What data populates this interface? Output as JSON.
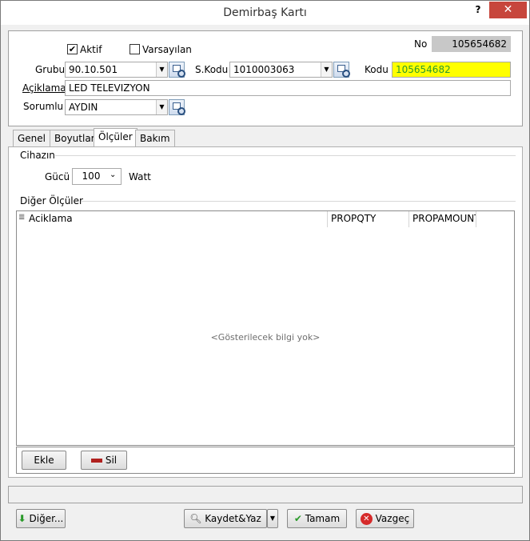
{
  "window": {
    "title": "Demirbaş Kartı",
    "help": "?",
    "close": "✕"
  },
  "header": {
    "aktif_label": "Aktif",
    "aktif_checked": "✔",
    "varsayilan_label": "Varsayılan",
    "varsayilan_checked": "",
    "no_label": "No",
    "no_value": "105654682",
    "grubu_label": "Grubu",
    "grubu_value": "90.10.501",
    "skodu_label": "S.Kodu",
    "skodu_value": "1010003063",
    "kodu_label": "Kodu",
    "kodu_value": "105654682",
    "kodu_bg": "#ffff00",
    "kodu_color": "#2c9a2c",
    "aciklama_label": "Açiklama",
    "aciklama_value": "LED TELEVIZYON",
    "sorumlu_label": "Sorumlu",
    "sorumlu_value": "AYDIN"
  },
  "tabs": [
    {
      "label": "Genel"
    },
    {
      "label": "Boyutlar"
    },
    {
      "label": "Ölçüler"
    },
    {
      "label": "Bakım"
    }
  ],
  "cihazin": {
    "group_title": "Cihazın",
    "gucu_label": "Gücü",
    "gucu_value": "100",
    "unit": "Watt"
  },
  "diger": {
    "group_title": "Diğer Ölçüler",
    "columns": [
      "Aciklama",
      "PROPQTY",
      "PROPAMOUNT"
    ],
    "empty_text": "<Gösterilecek bilgi yok>",
    "add_label": "Ekle",
    "delete_label": "Sil"
  },
  "footer": {
    "diger_label": "Diğer...",
    "kaydet_label": "Kaydet&Yaz",
    "tamam_label": "Tamam",
    "vazgec_label": "Vazgeç"
  }
}
